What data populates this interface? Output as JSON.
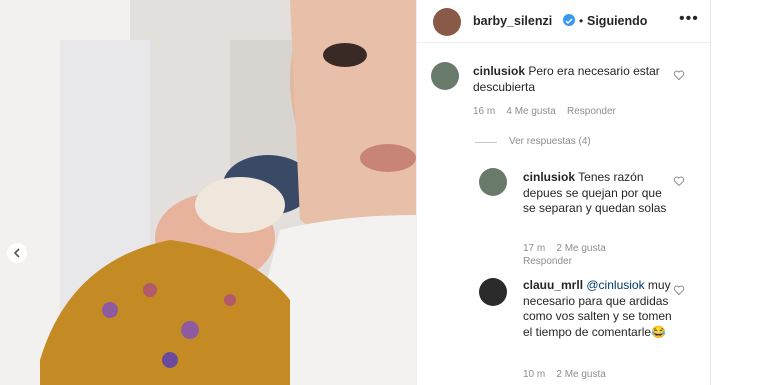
{
  "header": {
    "username": "barby_silenzi",
    "dot": "•",
    "follow_label": "Siguiendo",
    "more_icon": "more-options-icon"
  },
  "comments": [
    {
      "username": "cinlusiok",
      "text": "Pero era necesario estar descubierta",
      "time": "16 m",
      "likes": "4 Me gusta",
      "reply_label": "Responder",
      "view_replies": "Ver respuestas (4)"
    },
    {
      "username": "cinlusiok",
      "text": "Tenes razón depues se quejan por que se separan y quedan solas",
      "time": "17 m",
      "likes": "2 Me gusta",
      "reply_label": "Responder"
    },
    {
      "username": "clauu_mrll",
      "mention": "@cinlusiok",
      "text": "muy necesario para que ardidas como vos salten y se tomen el tiempo de comentarle😂",
      "time": "10 m",
      "likes": "2 Me gusta"
    }
  ]
}
